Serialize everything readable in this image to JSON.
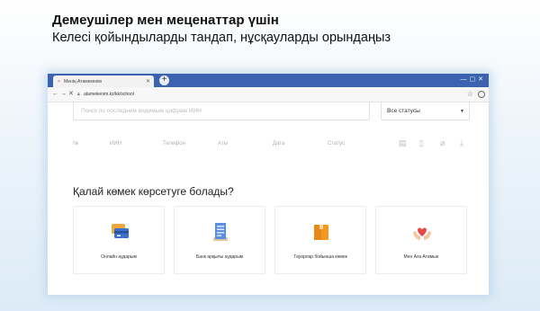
{
  "slide": {
    "title": "Демеушілер мен меценаттар үшін",
    "subtitle": "Келесі қойындыларды тандап, нұсқауларды орындаңыз"
  },
  "browser": {
    "tab_title": "Менің Атамекенім",
    "url": "atamekenim.kz/kk/school"
  },
  "page": {
    "search_placeholder": "Поиск по последним видимым цифрам ИИН",
    "status_select_value": "Все статусы",
    "table_columns": [
      "№",
      "ИИН",
      "Телефон",
      "Аты",
      "Дата",
      "Статус"
    ],
    "help_title": "Қалай көмек көрсетуге болады?",
    "cards": [
      {
        "label": "Онлайн аударым",
        "icon": "credit-card-icon"
      },
      {
        "label": "Банк арқылы аударым",
        "icon": "receipt-icon"
      },
      {
        "label": "Тауарлар бойынша көмек",
        "icon": "package-icon"
      },
      {
        "label": "Мен Аяз Атамын",
        "icon": "heart-hands-icon"
      }
    ]
  },
  "colors": {
    "tabbar": "#3b63b0",
    "card_blue": "#3d6fd1",
    "package_orange": "#f39a1e",
    "heart_red": "#e54848"
  }
}
